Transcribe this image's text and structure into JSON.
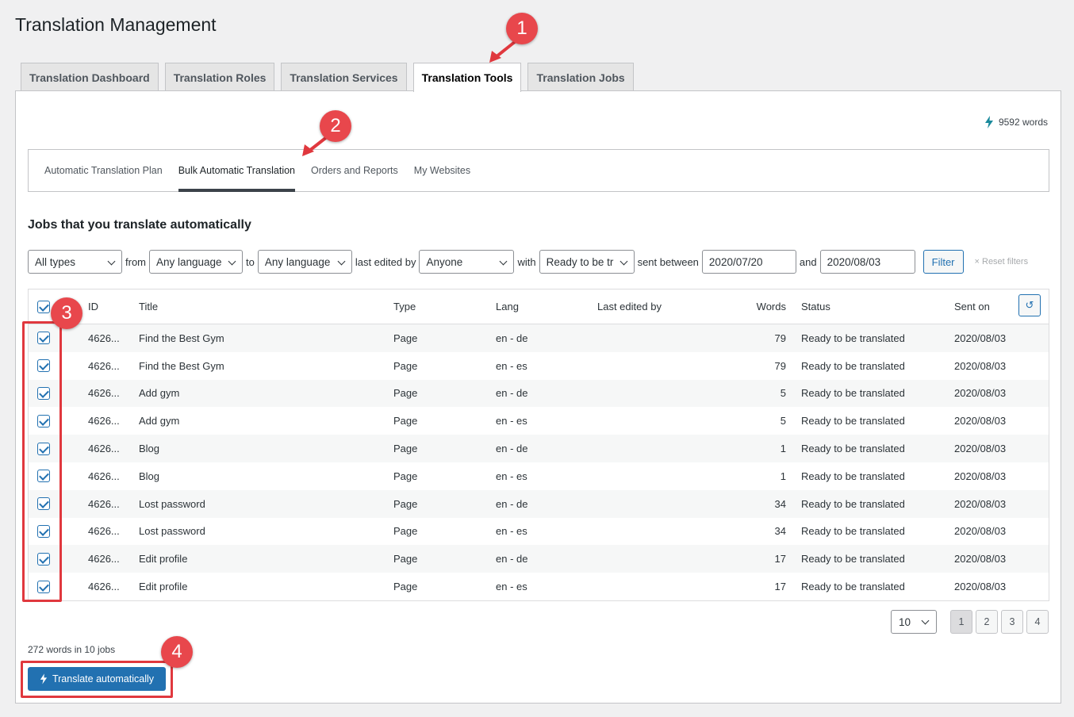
{
  "page": {
    "title": "Translation Management"
  },
  "tabs": [
    {
      "label": "Translation Dashboard",
      "active": false
    },
    {
      "label": "Translation Roles",
      "active": false
    },
    {
      "label": "Translation Services",
      "active": false
    },
    {
      "label": "Translation Tools",
      "active": true
    },
    {
      "label": "Translation Jobs",
      "active": false
    }
  ],
  "credits": {
    "text": "9592 words",
    "icon": "bolt-icon"
  },
  "subnav": [
    {
      "label": "Automatic Translation Plan",
      "active": false
    },
    {
      "label": "Bulk Automatic Translation",
      "active": true
    },
    {
      "label": "Orders and Reports",
      "active": false
    },
    {
      "label": "My Websites",
      "active": false
    }
  ],
  "section": {
    "title": "Jobs that you translate automatically"
  },
  "filters": {
    "type_value": "All types",
    "from_label": "from",
    "from_value": "Any language",
    "to_label": "to",
    "to_value": "Any language",
    "editor_label": "last edited by",
    "editor_value": "Anyone",
    "with_label": "with",
    "status_value": "Ready to be tr",
    "between_label": "sent between",
    "date_from": "2020/07/20",
    "and_label": "and",
    "date_to": "2020/08/03",
    "filter_button": "Filter",
    "reset_label": "× Reset filters"
  },
  "table": {
    "headers": {
      "id": "ID",
      "title": "Title",
      "type": "Type",
      "lang": "Lang",
      "editor": "Last edited by",
      "words": "Words",
      "status": "Status",
      "sent": "Sent on"
    },
    "rows": [
      {
        "id": "4626...",
        "title": "Find the Best Gym",
        "type": "Page",
        "lang": "en - de",
        "editor": "",
        "words": "79",
        "status": "Ready to be translated",
        "sent": "2020/08/03"
      },
      {
        "id": "4626...",
        "title": "Find the Best Gym",
        "type": "Page",
        "lang": "en - es",
        "editor": "",
        "words": "79",
        "status": "Ready to be translated",
        "sent": "2020/08/03"
      },
      {
        "id": "4626...",
        "title": "Add gym",
        "type": "Page",
        "lang": "en - de",
        "editor": "",
        "words": "5",
        "status": "Ready to be translated",
        "sent": "2020/08/03"
      },
      {
        "id": "4626...",
        "title": "Add gym",
        "type": "Page",
        "lang": "en - es",
        "editor": "",
        "words": "5",
        "status": "Ready to be translated",
        "sent": "2020/08/03"
      },
      {
        "id": "4626...",
        "title": "Blog",
        "type": "Page",
        "lang": "en - de",
        "editor": "",
        "words": "1",
        "status": "Ready to be translated",
        "sent": "2020/08/03"
      },
      {
        "id": "4626...",
        "title": "Blog",
        "type": "Page",
        "lang": "en - es",
        "editor": "",
        "words": "1",
        "status": "Ready to be translated",
        "sent": "2020/08/03"
      },
      {
        "id": "4626...",
        "title": "Lost password",
        "type": "Page",
        "lang": "en - de",
        "editor": "",
        "words": "34",
        "status": "Ready to be translated",
        "sent": "2020/08/03"
      },
      {
        "id": "4626...",
        "title": "Lost password",
        "type": "Page",
        "lang": "en - es",
        "editor": "",
        "words": "34",
        "status": "Ready to be translated",
        "sent": "2020/08/03"
      },
      {
        "id": "4626...",
        "title": "Edit profile",
        "type": "Page",
        "lang": "en - de",
        "editor": "",
        "words": "17",
        "status": "Ready to be translated",
        "sent": "2020/08/03"
      },
      {
        "id": "4626...",
        "title": "Edit profile",
        "type": "Page",
        "lang": "en - es",
        "editor": "",
        "words": "17",
        "status": "Ready to be translated",
        "sent": "2020/08/03"
      }
    ]
  },
  "pagination": {
    "per_page": "10",
    "pages": [
      "1",
      "2",
      "3",
      "4"
    ],
    "current": "1"
  },
  "summary": {
    "text": "272 words in 10 jobs"
  },
  "action": {
    "label": "Translate automatically"
  },
  "annotations": {
    "color": "#e0383e",
    "badges": [
      "1",
      "2",
      "3",
      "4"
    ]
  }
}
